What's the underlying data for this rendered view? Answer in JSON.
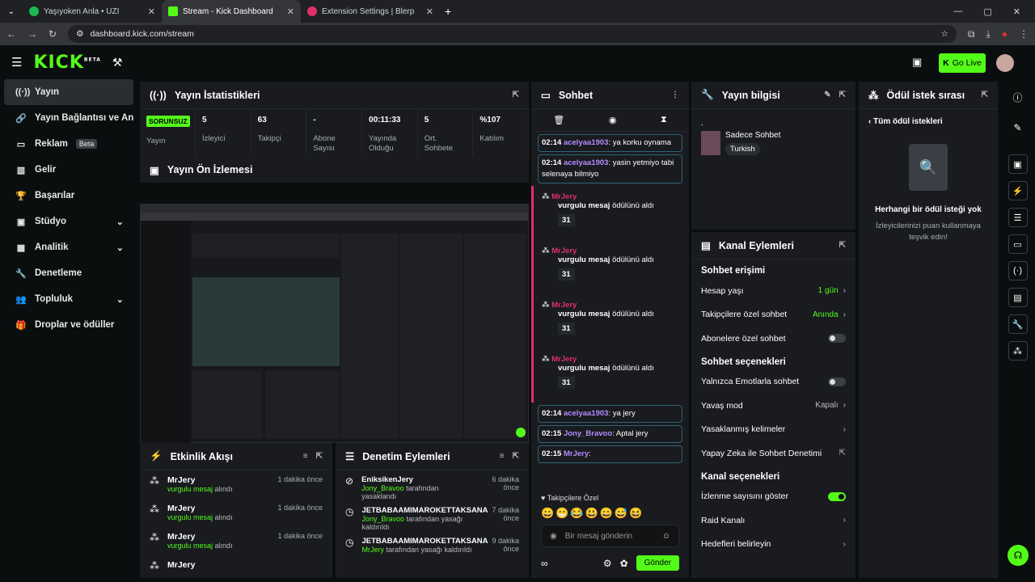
{
  "browser": {
    "tabs": [
      "Yaşıyoken Anla • UZI",
      "Stream - Kick Dashboard",
      "Extension Settings | Blerp"
    ],
    "url": "dashboard.kick.com/stream"
  },
  "app": {
    "logo": "KICK",
    "beta": "BETA",
    "go_live": "Go Live"
  },
  "sidebar": {
    "items": [
      {
        "label": "Yayın",
        "icon": "broadcast-icon"
      },
      {
        "label": "Yayın Bağlantısı ve Anahtarı",
        "icon": "link-icon"
      },
      {
        "label": "Reklam",
        "icon": "ad-icon",
        "badge": "Beta"
      },
      {
        "label": "Gelir",
        "icon": "chart-icon"
      },
      {
        "label": "Başarılar",
        "icon": "trophy-icon"
      },
      {
        "label": "Stüdyo",
        "icon": "studio-icon",
        "chevron": true
      },
      {
        "label": "Analitik",
        "icon": "analytics-icon",
        "chevron": true
      },
      {
        "label": "Denetleme",
        "icon": "wrench-icon"
      },
      {
        "label": "Topluluk",
        "icon": "users-icon",
        "chevron": true
      },
      {
        "label": "Droplar ve ödüller",
        "icon": "gift-icon"
      }
    ]
  },
  "stats": {
    "title": "Yayın İstatistikleri",
    "status": "SORUNSUZ",
    "items": [
      {
        "v": "",
        "l": "Yayın"
      },
      {
        "v": "5",
        "l": "İzleyici"
      },
      {
        "v": "63",
        "l": "Takipçi"
      },
      {
        "v": "-",
        "l": "Abone Sayısı"
      },
      {
        "v": "00:11:33",
        "l": "Yayında Olduğu"
      },
      {
        "v": "5",
        "l": "Ort. Sohbete"
      },
      {
        "v": "%107",
        "l": "Katılım"
      }
    ]
  },
  "preview": {
    "title": "Yayın Ön İzlemesi"
  },
  "feed": {
    "title": "Etkinlik Akışı",
    "rows": [
      {
        "n": "MrJery",
        "s1": "vurgulu mesaj",
        "s2": "alındı",
        "t": "1 dakika önce"
      },
      {
        "n": "MrJery",
        "s1": "vurgulu mesaj",
        "s2": "alındı",
        "t": "1 dakika önce"
      },
      {
        "n": "MrJery",
        "s1": "vurgulu mesaj",
        "s2": "alındı",
        "t": "1 dakika önce"
      },
      {
        "n": "MrJery",
        "s1": "",
        "s2": "",
        "t": ""
      }
    ]
  },
  "mod": {
    "title": "Denetim Eylemleri",
    "rows": [
      {
        "n": "EniksikenJery",
        "u": "Jony_Bravoo",
        "s": "tarafından yasaklandı",
        "t": "6 dakika önce"
      },
      {
        "n": "JETBABAAMIMAROKETTAKSANA",
        "u": "Jony_Bravoo",
        "s": "tarafından yasağı kaldırıldı",
        "t": "7 dakika önce"
      },
      {
        "n": "JETBABAAMIMAROKETTAKSANA",
        "u": "MrJery",
        "s": "tarafından yasağı kaldırıldı",
        "t": "9 dakika önce"
      }
    ]
  },
  "chat": {
    "title": "Sohbet",
    "messages": [
      {
        "t": "02:14",
        "u": "acelyaa1903",
        "m": "ya korku oynama"
      },
      {
        "t": "02:14",
        "u": "acelyaa1903",
        "m": "yasin yetmiyo tabi selenaya bilmiyo"
      }
    ],
    "reward_name": "MrJery",
    "reward_label": "vurgulu mesaj",
    "reward_suffix": "ödülünü aldı",
    "reward_count": "31",
    "later": [
      {
        "t": "02:14",
        "u": "acelyaa1903",
        "m": "ya jery"
      },
      {
        "t": "02:15",
        "u": "Jony_Bravoo",
        "m": "Aptal jery"
      },
      {
        "t": "02:15",
        "u": "MrJery",
        "m": ""
      }
    ],
    "followers_only": "Takipçilere Özel",
    "placeholder": "Bir mesaj gönderin",
    "send": "Gönder"
  },
  "info": {
    "title": "Yayın bilgisi",
    "dot": ".",
    "category": "Sadece Sohbet",
    "tag": "Turkish"
  },
  "reward_queue": {
    "title": "Ödül istek sırası",
    "back": "Tüm ödül istekleri",
    "empty_title": "Herhangi bir ödül isteği yok",
    "empty_sub": "İzleyicilerinizi puan kullanmaya teşvik edin!"
  },
  "actions": {
    "title": "Kanal Eylemleri",
    "s1": "Sohbet erişimi",
    "r1": [
      {
        "l": "Hesap yaşı",
        "v": "1 gün"
      },
      {
        "l": "Takipçilere özel sohbet",
        "v": "Anında"
      },
      {
        "l": "Abonelere özel sohbet",
        "v": ""
      }
    ],
    "s2": "Sohbet seçenekleri",
    "r2": [
      {
        "l": "Yalnızca Emotlarla sohbet",
        "v": ""
      },
      {
        "l": "Yavaş mod",
        "v": "Kapalı"
      },
      {
        "l": "Yasaklanmış kelimeler",
        "v": ""
      },
      {
        "l": "Yapay Zeka ile Sohbet Denetimi",
        "v": ""
      }
    ],
    "s3": "Kanal seçenekleri",
    "r3": [
      {
        "l": "İzlenme sayısını göster",
        "v": ""
      },
      {
        "l": "Raid Kanalı",
        "v": ""
      },
      {
        "l": "Hedefleri belirleyin",
        "v": ""
      }
    ]
  },
  "colors": {
    "accent": "#53fc18",
    "reward": "#e03068"
  }
}
